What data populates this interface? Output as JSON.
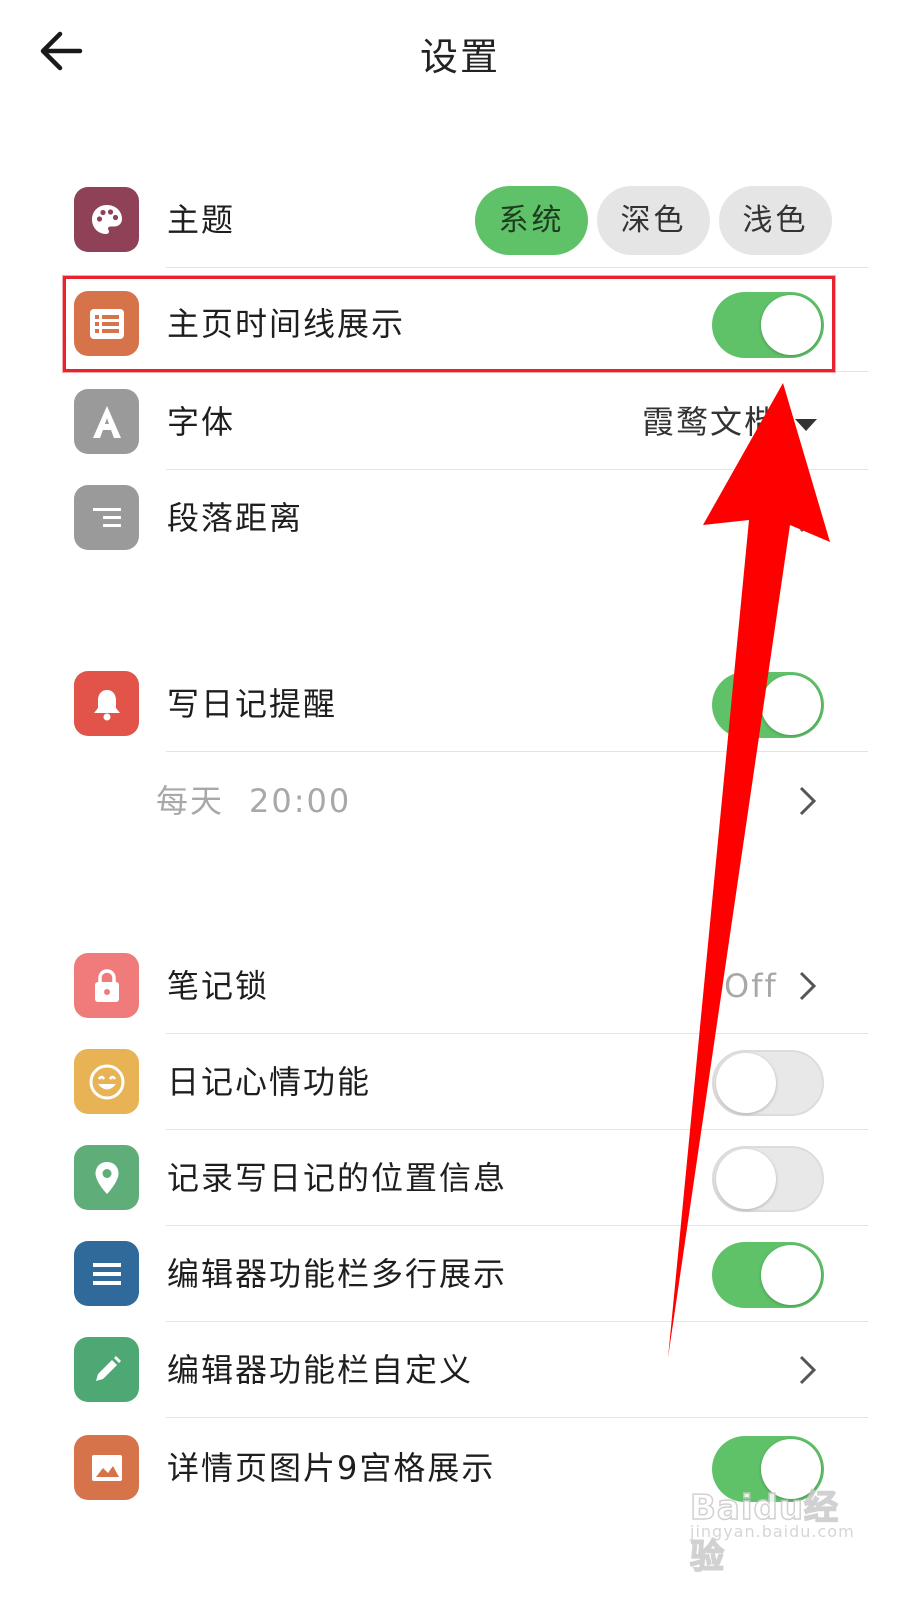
{
  "header": {
    "title": "设置",
    "back_icon": "arrow-left-icon"
  },
  "theme": {
    "label": "主题",
    "icon": "palette-icon",
    "icon_color": "#8e4157",
    "options": [
      "系统",
      "深色",
      "浅色"
    ],
    "selected": "系统"
  },
  "timeline": {
    "label": "主页时间线展示",
    "icon": "list-icon",
    "icon_color": "#d6734b",
    "enabled": true
  },
  "font": {
    "label": "字体",
    "icon": "letter-a-icon",
    "icon_color": "#9a9a9a",
    "value": "霞鹜文楷"
  },
  "paragraph": {
    "label": "段落距离",
    "icon": "align-right-icon",
    "icon_color": "#9a9a9a"
  },
  "reminder": {
    "label": "写日记提醒",
    "icon": "bell-icon",
    "icon_color": "#e2534a",
    "enabled": true,
    "schedule_day": "每天",
    "schedule_time": "20:00"
  },
  "lock": {
    "label": "笔记锁",
    "icon": "lock-icon",
    "icon_color": "#ef7c7b",
    "value": "Off"
  },
  "mood": {
    "label": "日记心情功能",
    "icon": "smiley-icon",
    "icon_color": "#e8b354",
    "enabled": false
  },
  "location": {
    "label": "记录写日记的位置信息",
    "icon": "map-pin-icon",
    "icon_color": "#5fad78",
    "enabled": false
  },
  "toolbar_multiline": {
    "label": "编辑器功能栏多行展示",
    "icon": "menu-lines-icon",
    "icon_color": "#2f6a9a",
    "enabled": true
  },
  "toolbar_custom": {
    "label": "编辑器功能栏自定义",
    "icon": "pencil-icon",
    "icon_color": "#4ea873"
  },
  "image_grid": {
    "label": "详情页图片9宫格展示",
    "icon": "image-icon",
    "icon_color": "#d6734b",
    "enabled": true
  },
  "watermark": {
    "text": "Baidu经验",
    "sub": "jingyan.baidu.com"
  },
  "annotation": {
    "highlight_color": "#e8232b",
    "arrow_color": "#ff0000"
  }
}
